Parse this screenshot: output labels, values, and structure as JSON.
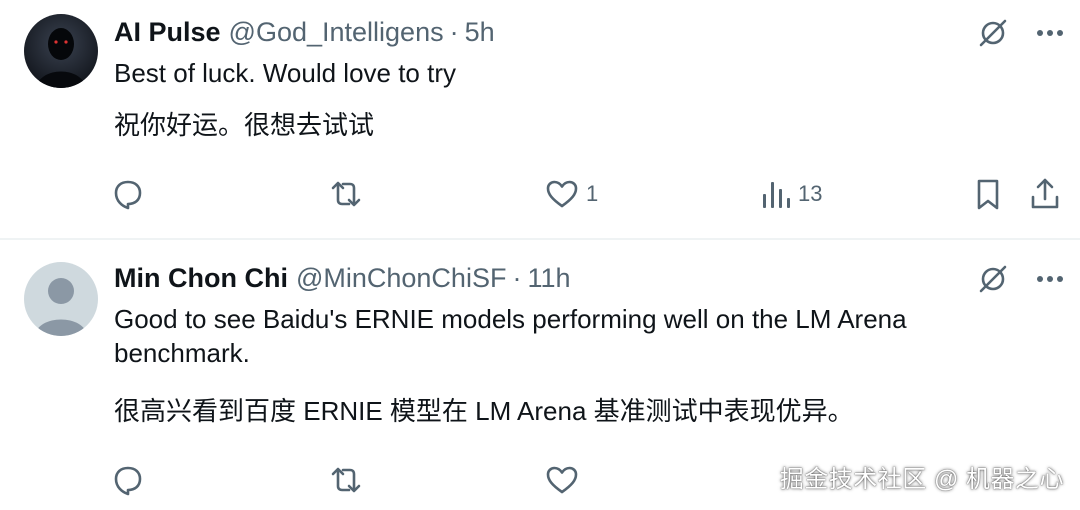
{
  "tweets": [
    {
      "name": "AI Pulse",
      "handle": "@God_Intelligens",
      "separator": "·",
      "time": "5h",
      "text_en": "Best of luck. Would love to try",
      "text_zh": "祝你好运。很想去试试",
      "likes": "1",
      "views": "13"
    },
    {
      "name": "Min Chon Chi",
      "handle": "@MinChonChiSF",
      "separator": "·",
      "time": "11h",
      "text_en": "Good to see Baidu's ERNIE models performing well on the LM Arena benchmark.",
      "text_zh": "很高兴看到百度 ERNIE 模型在 LM Arena 基准测试中表现优异。"
    }
  ],
  "watermark": "掘金技术社区 @ 机器之心",
  "icons": {
    "grok": "grok-icon",
    "more": "more-icon",
    "reply": "reply-icon",
    "retweet": "retweet-icon",
    "like": "like-icon",
    "views": "views-icon",
    "bookmark": "bookmark-icon",
    "share": "share-icon"
  },
  "colors": {
    "text_primary": "#0f1419",
    "text_secondary": "#536471",
    "divider": "#eff3f4"
  }
}
